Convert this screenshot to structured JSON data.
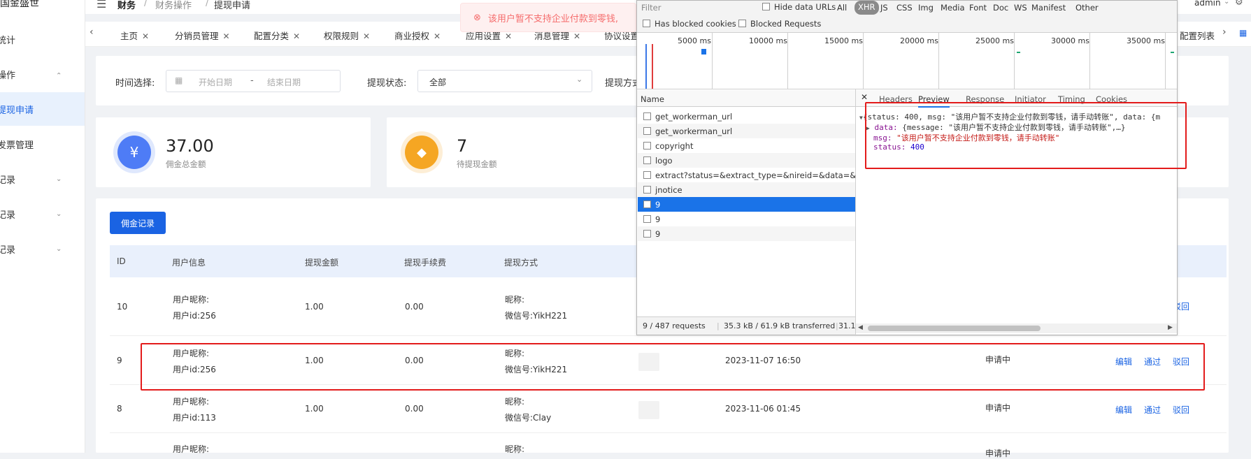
{
  "brand": "国金盛世",
  "sidebar": {
    "items": [
      {
        "label": "统计",
        "chevron": false
      },
      {
        "label": "操作",
        "chevron": true
      },
      {
        "label": "提现申请",
        "chevron": false,
        "active": true
      },
      {
        "label": "发票管理",
        "chevron": false
      },
      {
        "label": "记录",
        "chevron": true
      },
      {
        "label": "记录",
        "chevron": true
      },
      {
        "label": "记录",
        "chevron": true
      }
    ]
  },
  "breadcrumb": {
    "root": "财务",
    "mid": "财务操作",
    "leaf": "提现申请"
  },
  "admin_label": "admin",
  "tabs": [
    "主页",
    "分销员管理",
    "配置分类",
    "权限规则",
    "商业授权",
    "应用设置",
    "消息管理",
    "协议设置"
  ],
  "tab_right": "配置列表",
  "toast": "该用户暂不支持企业付款到零钱,",
  "filter": {
    "time_label": "时间选择:",
    "start_placeholder": "开始日期",
    "dash": "-",
    "end_placeholder": "结束日期",
    "status_label": "提现状态:",
    "status_value": "全部",
    "method_label": "提现方式"
  },
  "stats": [
    {
      "value": "37.00",
      "label": "佣金总金额",
      "color": "#4e7cf6"
    },
    {
      "value": "7",
      "label": "待提现金额",
      "color": "#f5a623"
    }
  ],
  "commission_button": "佣金记录",
  "table": {
    "headers": [
      "ID",
      "用户信息",
      "提现金额",
      "提现手续费",
      "提现方式"
    ],
    "rows": [
      {
        "id": "10",
        "nick": "用户昵称:",
        "uid": "用户id:256",
        "amount": "1.00",
        "fee": "0.00",
        "method1": "昵称:",
        "method2": "微信号:YikH221",
        "time": "",
        "status": "",
        "actions": [
          "驳回"
        ]
      },
      {
        "id": "9",
        "nick": "用户昵称:",
        "uid": "用户id:256",
        "amount": "1.00",
        "fee": "0.00",
        "method1": "昵称:",
        "method2": "微信号:YikH221",
        "time": "2023-11-07 16:50",
        "status": "申请中",
        "actions": [
          "编辑",
          "通过",
          "驳回"
        ]
      },
      {
        "id": "8",
        "nick": "用户昵称:",
        "uid": "用户id:113",
        "amount": "1.00",
        "fee": "0.00",
        "method1": "昵称:",
        "method2": "微信号:Clay",
        "time": "2023-11-06 01:45",
        "status": "申请中",
        "actions": [
          "编辑",
          "通过",
          "驳回"
        ]
      },
      {
        "id": "",
        "nick": "用户昵称:",
        "uid": "",
        "amount": "",
        "fee": "",
        "method1": "昵称:",
        "method2": "",
        "time": "",
        "status": "申请中",
        "actions": []
      }
    ]
  },
  "devtools": {
    "filter_placeholder": "Filter",
    "hide_data_urls": "Hide data URLs",
    "types": [
      "All",
      "XHR",
      "JS",
      "CSS",
      "Img",
      "Media",
      "Font",
      "Doc",
      "WS",
      "Manifest",
      "Other"
    ],
    "active_type": "XHR",
    "has_blocked": "Has blocked cookies",
    "blocked_requests": "Blocked Requests",
    "timeline": [
      "5000 ms",
      "10000 ms",
      "15000 ms",
      "20000 ms",
      "25000 ms",
      "30000 ms",
      "35000 ms"
    ],
    "name_header": "Name",
    "requests": [
      "get_workerman_url",
      "get_workerman_url",
      "copyright",
      "logo",
      "extract?status=&extract_type=&nireid=&data=&pa...",
      "jnotice",
      "9",
      "9",
      "9"
    ],
    "selected_index": 6,
    "detail_tabs": [
      "Headers",
      "Preview",
      "Response",
      "Initiator",
      "Timing",
      "Cookies"
    ],
    "active_detail_tab": "Preview",
    "preview": {
      "line1": "{status: 400, msg: \"该用户暂不支持企业付款到零钱，请手动转账\", data: {m",
      "line2_key": "data:",
      "line2_val": " {message: \"该用户暂不支持企业付款到零钱，请手动转账\",…}",
      "line3_key": "msg:",
      "line3_val": "\"该用户暂不支持企业付款到零钱，请手动转账\"",
      "line4_key": "status:",
      "line4_val": "400"
    },
    "status_bar": {
      "requests": "9 / 487 requests",
      "transfer": "35.3 kB / 61.9 kB transferred",
      "extra": "31.1"
    }
  }
}
